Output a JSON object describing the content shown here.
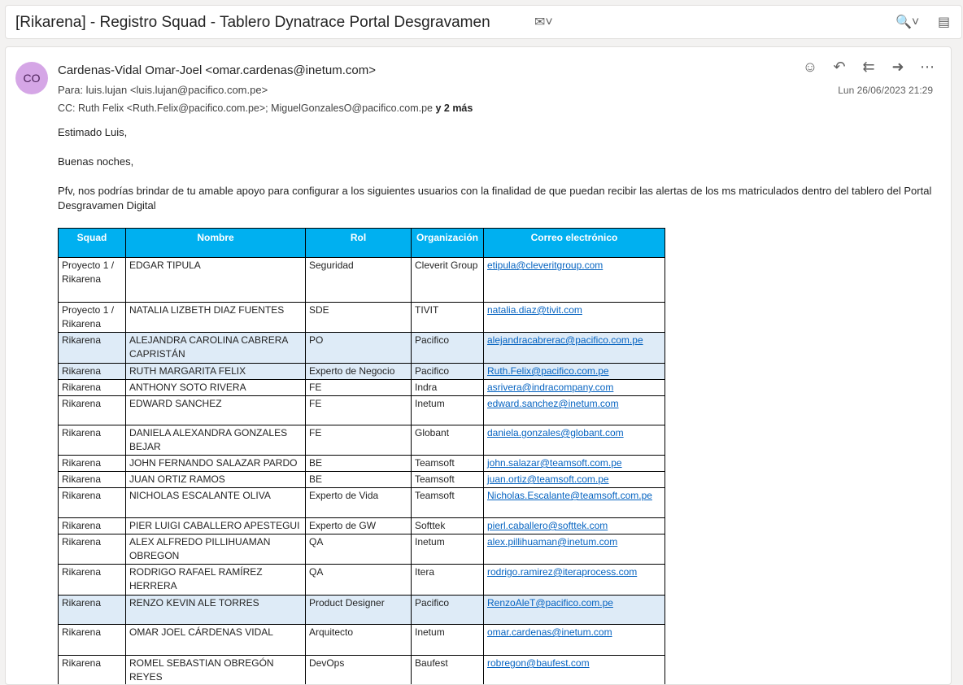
{
  "subject": "[Rikarena] - Registro Squad - Tablero Dynatrace Portal Desgravamen",
  "sender": {
    "initials": "CO",
    "from": "Cardenas-Vidal Omar-Joel <omar.cardenas@inetum.com>",
    "to": "Para:  luis.lujan <luis.lujan@pacifico.com.pe>",
    "cc": "CC:  Ruth Felix <Ruth.Felix@pacifico.com.pe>;  MiguelGonzalesO@pacifico.com.pe",
    "cc_more": "y 2 más",
    "date": "Lun 26/06/2023 21:29"
  },
  "body": {
    "greeting": "Estimado Luis,",
    "salutation": "Buenas noches,",
    "paragraph": "Pfv, nos podrías brindar de tu amable apoyo para configurar a los siguientes usuarios con la finalidad de que puedan recibir las alertas de los ms matriculados dentro del tablero del Portal Desgravamen Digital"
  },
  "table": {
    "headers": [
      "Squad",
      "Nombre",
      "Rol",
      "Organización",
      "Correo electrónico"
    ],
    "rows": [
      {
        "squad": "Proyecto 1 / Rikarena",
        "nombre": "EDGAR TIPULA",
        "rol": "Seguridad",
        "org": "Cleverit Group",
        "email": "etipula@cleveritgroup.com"
      },
      {
        "squad": "Proyecto 1 / Rikarena",
        "nombre": "NATALIA LIZBETH DIAZ FUENTES",
        "rol": "SDE",
        "org": "TIVIT",
        "email": "natalia.diaz@tivit.com"
      },
      {
        "squad": "Rikarena",
        "nombre": "ALEJANDRA CAROLINA CABRERA CAPRISTÁN",
        "rol": "PO",
        "org": "Pacifico",
        "email": "alejandracabrerac@pacifico.com.pe"
      },
      {
        "squad": "Rikarena",
        "nombre": "RUTH MARGARITA FELIX",
        "rol": "Experto de Negocio",
        "org": "Pacifico",
        "email": "Ruth.Felix@pacifico.com.pe"
      },
      {
        "squad": "Rikarena",
        "nombre": "ANTHONY SOTO RIVERA",
        "rol": "FE",
        "org": "Indra",
        "email": "asrivera@indracompany.com"
      },
      {
        "squad": "Rikarena",
        "nombre": "EDWARD SANCHEZ",
        "rol": "FE",
        "org": "Inetum",
        "email": "edward.sanchez@inetum.com"
      },
      {
        "squad": "Rikarena",
        "nombre": "DANIELA ALEXANDRA GONZALES BEJAR",
        "rol": "FE",
        "org": "Globant",
        "email": "daniela.gonzales@globant.com"
      },
      {
        "squad": "Rikarena",
        "nombre": "JOHN FERNANDO SALAZAR PARDO",
        "rol": "BE",
        "org": "Teamsoft",
        "email": "john.salazar@teamsoft.com.pe"
      },
      {
        "squad": "Rikarena",
        "nombre": "JUAN ORTIZ RAMOS",
        "rol": "BE",
        "org": "Teamsoft",
        "email": "juan.ortiz@teamsoft.com.pe"
      },
      {
        "squad": "Rikarena",
        "nombre": "NICHOLAS ESCALANTE OLIVA",
        "rol": "Experto de Vida",
        "org": "Teamsoft",
        "email": "Nicholas.Escalante@teamsoft.com.pe"
      },
      {
        "squad": "Rikarena",
        "nombre": "PIER LUIGI CABALLERO APESTEGUI",
        "rol": "Experto de GW",
        "org": "Softtek",
        "email": "pierl.caballero@softtek.com"
      },
      {
        "squad": "Rikarena",
        "nombre": "ALEX ALFREDO PILLIHUAMAN OBREGON",
        "rol": "QA",
        "org": "Inetum",
        "email": "alex.pillihuaman@inetum.com"
      },
      {
        "squad": "Rikarena",
        "nombre": "RODRIGO RAFAEL RAMÍREZ HERRERA",
        "rol": "QA",
        "org": "Itera",
        "email": "rodrigo.ramirez@iteraprocess.com"
      },
      {
        "squad": "Rikarena",
        "nombre": "RENZO KEVIN ALE TORRES",
        "rol": "Product Designer",
        "org": "Pacifico",
        "email": "RenzoAleT@pacifico.com.pe"
      },
      {
        "squad": "Rikarena",
        "nombre": "OMAR JOEL CÁRDENAS VIDAL",
        "rol": "Arquitecto",
        "org": "Inetum",
        "email": "omar.cardenas@inetum.com"
      },
      {
        "squad": "Rikarena",
        "nombre": "ROMEL SEBASTIAN OBREGÓN REYES",
        "rol": "DevOps",
        "org": "Baufest",
        "email": "robregon@baufest.com"
      }
    ]
  }
}
